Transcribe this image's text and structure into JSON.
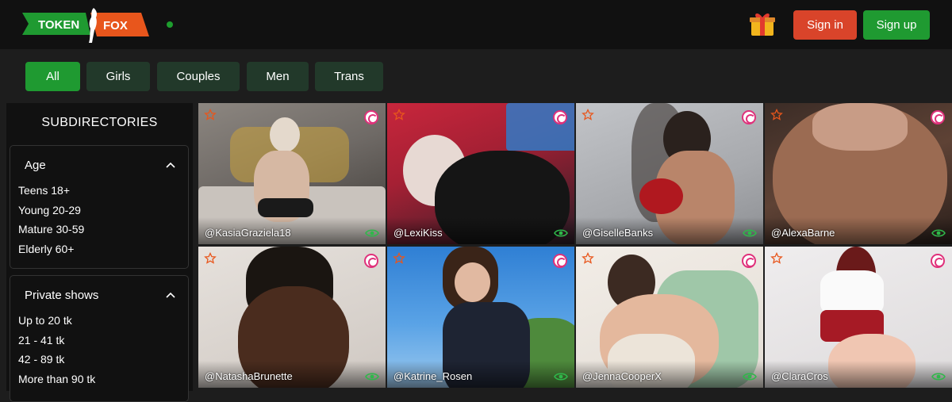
{
  "header": {
    "logo_left": "TOKEN",
    "logo_right": "FOX",
    "logo_icon": "fox-silhouette-logo",
    "gift_icon": "gift-icon",
    "sign_in_label": "Sign in",
    "sign_up_label": "Sign up"
  },
  "filters": [
    {
      "label": "All",
      "active": true
    },
    {
      "label": "Girls",
      "active": false
    },
    {
      "label": "Couples",
      "active": false
    },
    {
      "label": "Men",
      "active": false
    },
    {
      "label": "Trans",
      "active": false
    }
  ],
  "sidebar": {
    "title": "SUBDIRECTORIES",
    "groups": [
      {
        "title": "Age",
        "items": [
          "Teens 18+",
          "Young 20-29",
          "Mature 30-59",
          "Elderly 60+"
        ]
      },
      {
        "title": "Private shows",
        "items": [
          "Up to 20 tk",
          "21 - 41 tk",
          "42 - 89 tk",
          "More than 90 tk"
        ]
      }
    ]
  },
  "performers": [
    {
      "name": "@KasiaGraziela18"
    },
    {
      "name": "@LexiKiss"
    },
    {
      "name": "@GiselleBanks"
    },
    {
      "name": "@AlexaBarne"
    },
    {
      "name": "@NatashaBrunette"
    },
    {
      "name": "@Katrine_Rosen"
    },
    {
      "name": "@JennaCooperX"
    },
    {
      "name": "@ClaraCros"
    }
  ],
  "colors": {
    "accent_green": "#1f9a31",
    "accent_orange": "#d9442a",
    "badge_pink": "#e0317b",
    "eye_green": "#2fb84a"
  }
}
